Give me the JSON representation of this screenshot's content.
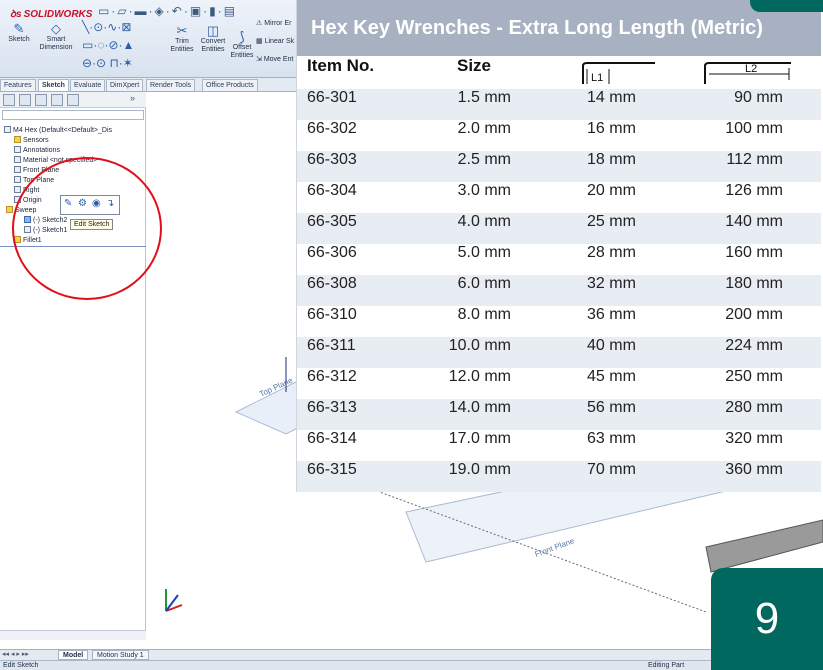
{
  "solidworks": {
    "logo": "SOLIDWORKS",
    "toolbar": {
      "sketch": "Sketch",
      "smart_dimension_line1": "Smart",
      "smart_dimension_line2": "Dimension",
      "trim_line1": "Trim",
      "trim_line2": "Entities",
      "convert_line1": "Convert",
      "convert_line2": "Entities",
      "offset_line1": "Offset",
      "offset_line2": "Entities",
      "mirror": "Mirror Er",
      "linear": "Linear Sk",
      "move": "Move Ent"
    },
    "command_tabs": [
      "Features",
      "Sketch",
      "Evaluate",
      "DimXpert",
      "Render Tools",
      "Office Products"
    ],
    "active_tab": "Sketch",
    "tree": {
      "root": "M4 Hex  (Default<<Default>_Dis",
      "items": [
        "Sensors",
        "Annotations",
        "Material <not specified>",
        "Front Plane",
        "Top Plane",
        "Right",
        "Origin",
        "Sweep",
        "(-) Sketch2",
        "(-) Sketch1",
        "Fillet1"
      ],
      "tooltip": "Edit Sketch"
    },
    "model_tabs": [
      "Model",
      "Motion Study 1"
    ],
    "active_model_tab": "Model",
    "status_left": "Edit Sketch",
    "status_right": "Editing Part",
    "viewport_labels": {
      "top_plane": "Top Plane",
      "front_plane": "Front Plane"
    }
  },
  "table": {
    "title": "Hex Key Wrenches - Extra Long Length (Metric)",
    "headers": {
      "item_no": "Item No.",
      "size": "Size",
      "l1": "L1",
      "l2": "L2"
    },
    "rows": [
      {
        "item": "66-301",
        "size": "1.5 mm",
        "l1": "14 mm",
        "l2": "90 mm"
      },
      {
        "item": "66-302",
        "size": "2.0 mm",
        "l1": "16 mm",
        "l2": "100 mm"
      },
      {
        "item": "66-303",
        "size": "2.5 mm",
        "l1": "18 mm",
        "l2": "112 mm"
      },
      {
        "item": "66-304",
        "size": "3.0 mm",
        "l1": "20 mm",
        "l2": "126 mm"
      },
      {
        "item": "66-305",
        "size": "4.0 mm",
        "l1": "25 mm",
        "l2": "140 mm"
      },
      {
        "item": "66-306",
        "size": "5.0 mm",
        "l1": "28 mm",
        "l2": "160 mm"
      },
      {
        "item": "66-308",
        "size": "6.0 mm",
        "l1": "32 mm",
        "l2": "180 mm"
      },
      {
        "item": "66-310",
        "size": "8.0 mm",
        "l1": "36 mm",
        "l2": "200 mm"
      },
      {
        "item": "66-311",
        "size": "10.0 mm",
        "l1": "40 mm",
        "l2": "224 mm"
      },
      {
        "item": "66-312",
        "size": "12.0 mm",
        "l1": "45 mm",
        "l2": "250 mm"
      },
      {
        "item": "66-313",
        "size": "14.0 mm",
        "l1": "56 mm",
        "l2": "280 mm"
      },
      {
        "item": "66-314",
        "size": "17.0 mm",
        "l1": "63 mm",
        "l2": "320 mm"
      },
      {
        "item": "66-315",
        "size": "19.0 mm",
        "l1": "70 mm",
        "l2": "360 mm"
      }
    ]
  },
  "slide_number": "9",
  "colors": {
    "title_bar": "#a7b1c1",
    "stripe": "#e8ecf3",
    "badge": "#00685e",
    "highlight_circle": "#e0101a"
  }
}
